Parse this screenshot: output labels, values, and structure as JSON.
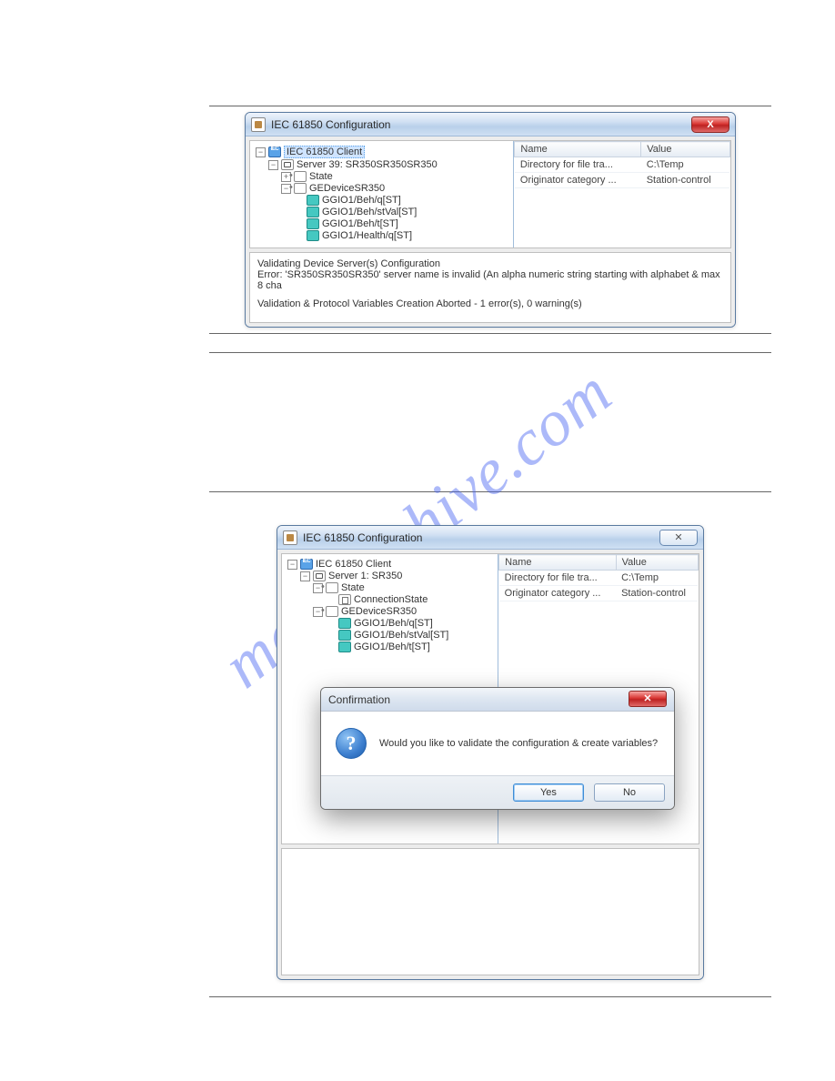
{
  "watermark": "manualshive.com",
  "figure1": {
    "window_title": "IEC 61850 Configuration",
    "close_glyph": "X",
    "tree": {
      "root": "IEC 61850 Client",
      "server": "Server 39: SR350SR350SR350",
      "state": "State",
      "device": "GEDeviceSR350",
      "leaves": [
        "GGIO1/Beh/q[ST]",
        "GGIO1/Beh/stVal[ST]",
        "GGIO1/Beh/t[ST]",
        "GGIO1/Health/q[ST]"
      ]
    },
    "prop_headers": {
      "name": "Name",
      "value": "Value"
    },
    "props": [
      {
        "name": "Directory for file tra...",
        "value": "C:\\Temp"
      },
      {
        "name": "Originator category ...",
        "value": "Station-control"
      }
    ],
    "log": {
      "l1": "Validating Device Server(s) Configuration",
      "l2": "Error: 'SR350SR350SR350' server name is invalid (An alpha numeric string starting with alphabet & max 8 cha",
      "l3": "Validation & Protocol Variables Creation Aborted  -  1 error(s), 0 warning(s)"
    }
  },
  "figure2": {
    "window_title": "IEC 61850 Configuration",
    "close_glyph": "✕",
    "tree": {
      "root": "IEC 61850 Client",
      "server": "Server 1: SR350",
      "state": "State",
      "conn": "ConnectionState",
      "device": "GEDeviceSR350",
      "leaves": [
        "GGIO1/Beh/q[ST]",
        "GGIO1/Beh/stVal[ST]",
        "GGIO1/Beh/t[ST]"
      ]
    },
    "prop_headers": {
      "name": "Name",
      "value": "Value"
    },
    "props": [
      {
        "name": "Directory for file tra...",
        "value": "C:\\Temp"
      },
      {
        "name": "Originator category ...",
        "value": "Station-control"
      }
    ],
    "modal": {
      "title": "Confirmation",
      "close_glyph": "✕",
      "message": "Would you like to validate the configuration & create variables?",
      "yes": "Yes",
      "no": "No"
    }
  }
}
